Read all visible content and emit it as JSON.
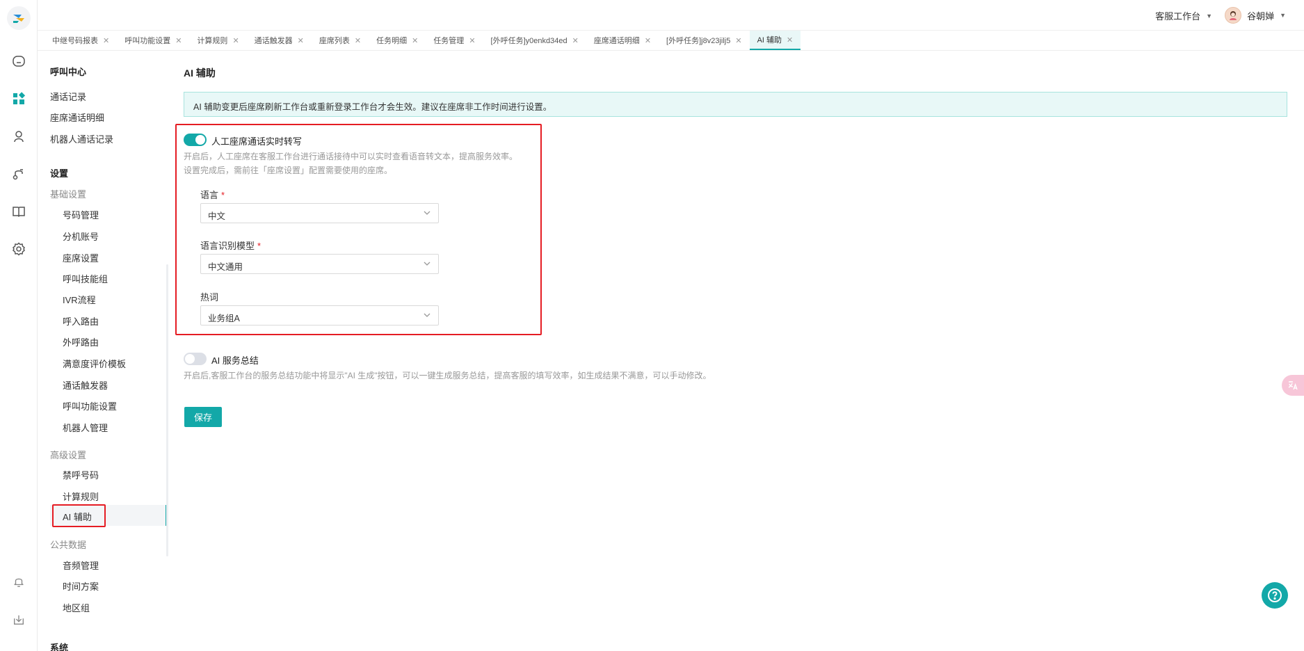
{
  "topbar": {
    "workspace_label": "客服工作台",
    "user_name": "谷朝婵"
  },
  "tabs": [
    {
      "label": "中继号码报表"
    },
    {
      "label": "呼叫功能设置"
    },
    {
      "label": "计算规则"
    },
    {
      "label": "通话触发器"
    },
    {
      "label": "座席列表"
    },
    {
      "label": "任务明细"
    },
    {
      "label": "任务管理"
    },
    {
      "label": "[外呼任务]y0enkd34ed"
    },
    {
      "label": "座席通话明细"
    },
    {
      "label": "[外呼任务]j8v23jilj5"
    },
    {
      "label": "AI 辅助"
    }
  ],
  "sidebar": {
    "call_center_title": "呼叫中心",
    "call_items": [
      "通话记录",
      "座席通话明细",
      "机器人通话记录"
    ],
    "settings_title": "设置",
    "basic_group": "基础设置",
    "basic_items": [
      "号码管理",
      "分机账号",
      "座席设置",
      "呼叫技能组",
      "IVR流程",
      "呼入路由",
      "外呼路由",
      "满意度评价模板",
      "通话触发器",
      "呼叫功能设置",
      "机器人管理"
    ],
    "advanced_group": "高级设置",
    "advanced_items": [
      "禁呼号码",
      "计算规则",
      "AI 辅助"
    ],
    "public_group": "公共数据",
    "public_items": [
      "音频管理",
      "时间方案",
      "地区组"
    ],
    "system_title": "系统"
  },
  "content": {
    "page_title": "AI 辅助",
    "notice": "AI 辅助变更后座席刷新工作台或重新登录工作台才会生效。建议在座席非工作时间进行设置。",
    "transcription": {
      "label": "人工座席通话实时转写",
      "enabled": true,
      "desc_line1": "开启后，人工座席在客服工作台进行通话接待中可以实时查看语音转文本，提高服务效率。",
      "desc_line2": "设置完成后，需前往「座席设置」配置需要使用的座席。",
      "language_label": "语言",
      "language_value": "中文",
      "model_label": "语言识别模型",
      "model_value": "中文通用",
      "hotword_label": "热词",
      "hotword_value": "业务组A"
    },
    "summary": {
      "label": "AI 服务总结",
      "enabled": false,
      "desc": "开启后,客服工作台的服务总结功能中将显示\"AI 生成\"按钮，可以一键生成服务总结，提高客服的填写效率，如生成结果不满意，可以手动修改。"
    },
    "save_label": "保存"
  },
  "colors": {
    "accent": "#13a8a8",
    "highlight_box": "#e51c23",
    "notice_bg": "#e8f8f7"
  }
}
